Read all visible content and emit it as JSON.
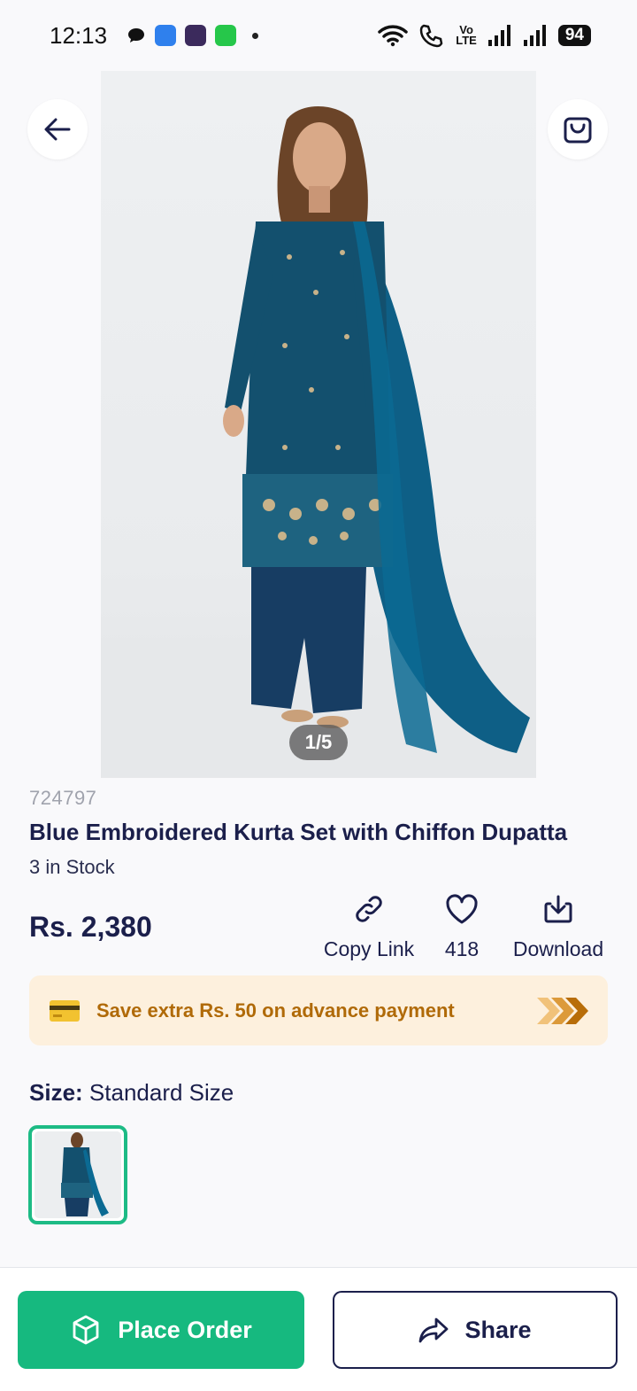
{
  "status_bar": {
    "time": "12:13",
    "network_label": "Vo\nLTE",
    "battery": "94",
    "icons": [
      "chat-bubble-icon",
      "app-blue-icon",
      "app-calendar-icon",
      "app-green-icon",
      "wifi-icon",
      "call-icon",
      "signal-icon"
    ]
  },
  "gallery": {
    "counter": "1/5",
    "back_icon": "arrow-left-icon",
    "cart_icon": "shopping-bag-icon"
  },
  "product": {
    "sku": "724797",
    "title": "Blue Embroidered Kurta Set with Chiffon Dupatta",
    "stock": "3 in Stock",
    "price": "Rs. 2,380"
  },
  "actions": {
    "copy_link": "Copy Link",
    "likes": "418",
    "download": "Download"
  },
  "promo": {
    "text": "Save extra Rs. 50 on advance payment",
    "icon": "credit-card-icon"
  },
  "size": {
    "label": "Size:",
    "value": "Standard Size"
  },
  "bottom": {
    "place_order": "Place Order",
    "share": "Share"
  },
  "colors": {
    "primary_green": "#16b97f",
    "navy_text": "#1b1f4b",
    "promo_bg": "#fdf0dd",
    "promo_text": "#b06a08",
    "garment_teal": "#0f5a78"
  }
}
